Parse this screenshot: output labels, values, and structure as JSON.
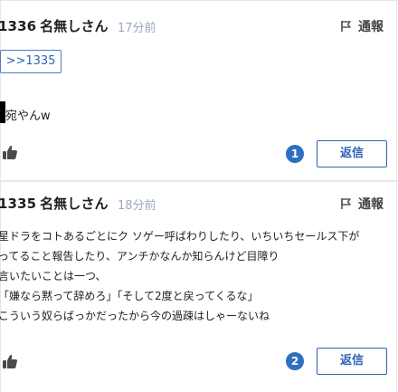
{
  "comments": [
    {
      "number": "1336",
      "name": "名無しさん",
      "time": "17分前",
      "report_label": "通報",
      "anchor": ">>1335",
      "text": "宛やんw",
      "reply_count": "1",
      "reply_label": "返信"
    },
    {
      "number": "1335",
      "name": "名無しさん",
      "time": "18分前",
      "report_label": "通報",
      "lines": [
        "星ドラをコトあるごとにク ソゲー呼ばわりしたり、いちいちセールス下が",
        "ってること報告したり、アンチかなんか知らんけど目障り",
        "言いたいことは一つ、",
        "「嫌なら黙って辞めろ」「そして2度と戻ってくるな」",
        "こういう奴らばっかだったから今の過疎はしゃーないね"
      ],
      "reply_count": "2",
      "reply_label": "返信"
    }
  ],
  "colors": {
    "accent": "#2f6fc0",
    "time_text": "#9aa8c0",
    "divider": "#e9e9e9"
  },
  "icons": {
    "report": "flag-icon",
    "like": "thumbs-up-icon"
  }
}
